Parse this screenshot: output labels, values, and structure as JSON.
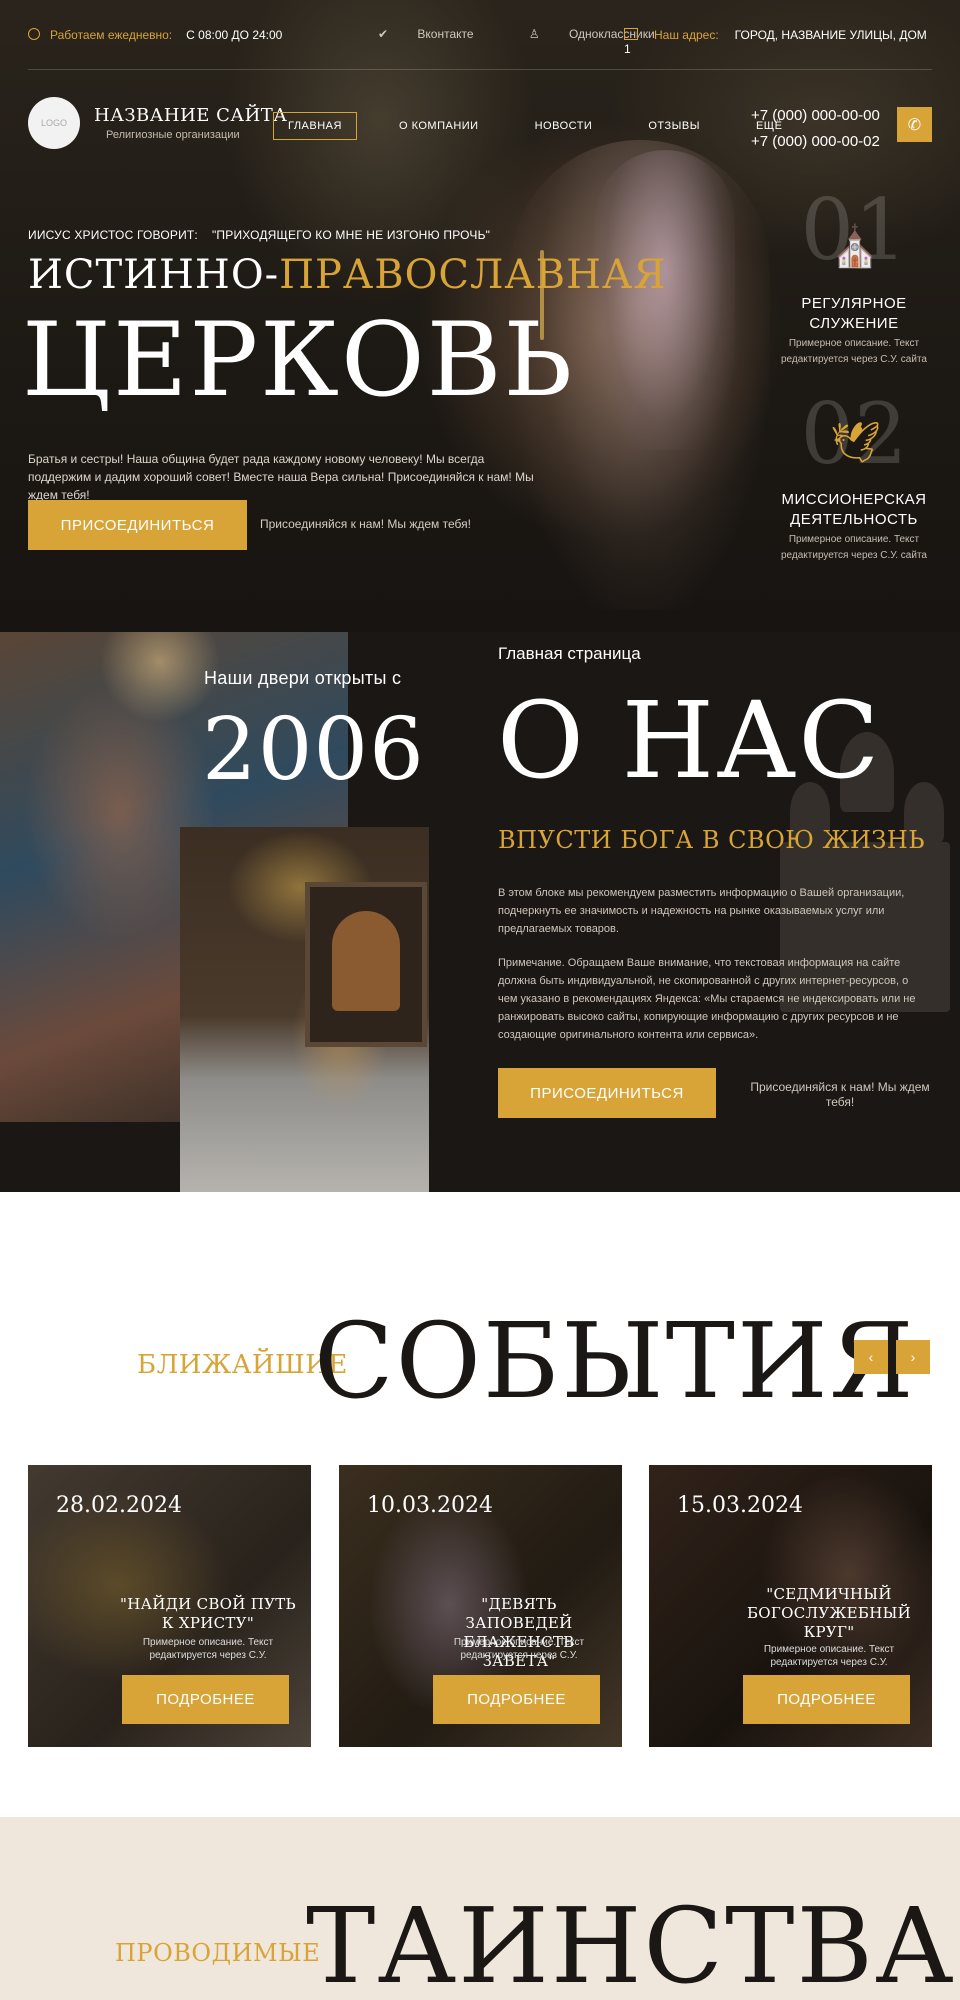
{
  "topbar": {
    "hours_label": "Работаем ежедневно:",
    "hours_value": "С 08:00 ДО 24:00",
    "social": [
      "Вконтакте",
      "Одноклассники"
    ],
    "address_label": "Наш адрес:",
    "address_value": "ГОРОД, НАЗВАНИЕ УЛИЦЫ, ДОМ 1"
  },
  "header": {
    "logo": "LOGO",
    "site_name": "НАЗВАНИЕ САЙТА",
    "site_sub": "Религиозные организации",
    "menu": [
      "ГЛАВНАЯ",
      "О КОМПАНИИ",
      "НОВОСТИ",
      "ОТЗЫВЫ",
      "ЕЩЁ"
    ],
    "phones": [
      "+7 (000) 000-00-00",
      "+7 (000) 000-00-02"
    ],
    "phone_icon": "phone-icon"
  },
  "hero": {
    "quote_label": "ИИСУС ХРИСТОС ГОВОРИТ:",
    "quote_text": "\"ПРИХОДЯЩЕГО КО МНЕ НЕ ИЗГОНЮ ПРОЧЬ\"",
    "title_white": "ИСТИННО-",
    "title_gold": "ПРАВОСЛАВНАЯ",
    "title_big": "ЦЕРКОВЬ",
    "description": "Братья и сестры!  Наша община будет рада каждому новому человеку! Мы всегда поддержим и дадим хороший совет! Вместе наша Вера сильна! Присоединяйся к нам! Мы ждем тебя!",
    "button": "ПРИСОЕДИНИТЬСЯ",
    "button_note": "Присоединяйся к нам! Мы ждем тебя!",
    "features": [
      {
        "num": "01",
        "icon": "church-icon",
        "title": "РЕГУЛЯРНОЕ СЛУЖЕНИЕ",
        "desc": "Примерное описание. Текст редактируется через С.У. сайта"
      },
      {
        "num": "02",
        "icon": "dove-icon",
        "title": "МИССИОНЕРСКАЯ ДЕЯТЕЛЬНОСТЬ",
        "desc": "Примерное описание. Текст редактируется через С.У. сайта"
      }
    ]
  },
  "about": {
    "doors_text": "Наши двери открыты с",
    "year": "2006",
    "breadcrumb": "Главная страница",
    "title": "О НАС",
    "subtitle": "ВПУСТИ БОГА В СВОЮ ЖИЗНЬ",
    "p1": "В этом блоке мы рекомендуем разместить информацию о Вашей организации, подчеркнуть ее значимость и надежность на рынке оказываемых услуг или предлагаемых товаров.",
    "p2": "Примечание. Обращаем Ваше внимание, что текстовая информация на сайте должна быть индивидуальной, не скопированной с других интернет-ресурсов, о чем указано в рекомендациях Яндекса: «Мы стараемся не индексировать или не ранжировать высоко сайты, копирующие информацию с других ресурсов и не создающие оригинального контента или сервиса».",
    "button": "ПРИСОЕДИНИТЬСЯ",
    "button_note": "Присоединяйся к нам! Мы ждем тебя!"
  },
  "events": {
    "pre_title": "БЛИЖАЙШИЕ",
    "title": "СОБЫТИЯ",
    "prev": "‹",
    "next": "›",
    "cards": [
      {
        "date": "28.02.2024",
        "title": "\"НАЙДИ СВОЙ ПУТЬ К ХРИСТУ\"",
        "desc": "Примерное описание. Текст редактируется через С.У.",
        "button": "ПОДРОБНЕЕ"
      },
      {
        "date": "10.03.2024",
        "title": "\"ДЕВЯТЬ ЗАПОВЕДЕЙ БЛАЖЕНСТВ ЗАВЕТА\"",
        "desc": "Примерное описание. Текст редактируется через С.У.",
        "button": "ПОДРОБНЕЕ"
      },
      {
        "date": "15.03.2024",
        "title": "\"СЕДМИЧНЫЙ БОГОСЛУЖЕБНЫЙ КРУГ\"",
        "desc": "Примерное описание. Текст редактируется через С.У.",
        "button": "ПОДРОБНЕЕ"
      }
    ]
  },
  "sacraments": {
    "pre_title": "ПРОВОДИМЫЕ",
    "title": "ТАИНСТВА"
  },
  "colors": {
    "accent": "#d8a437",
    "dark": "#1b1714",
    "cream": "#f0e7dc"
  }
}
